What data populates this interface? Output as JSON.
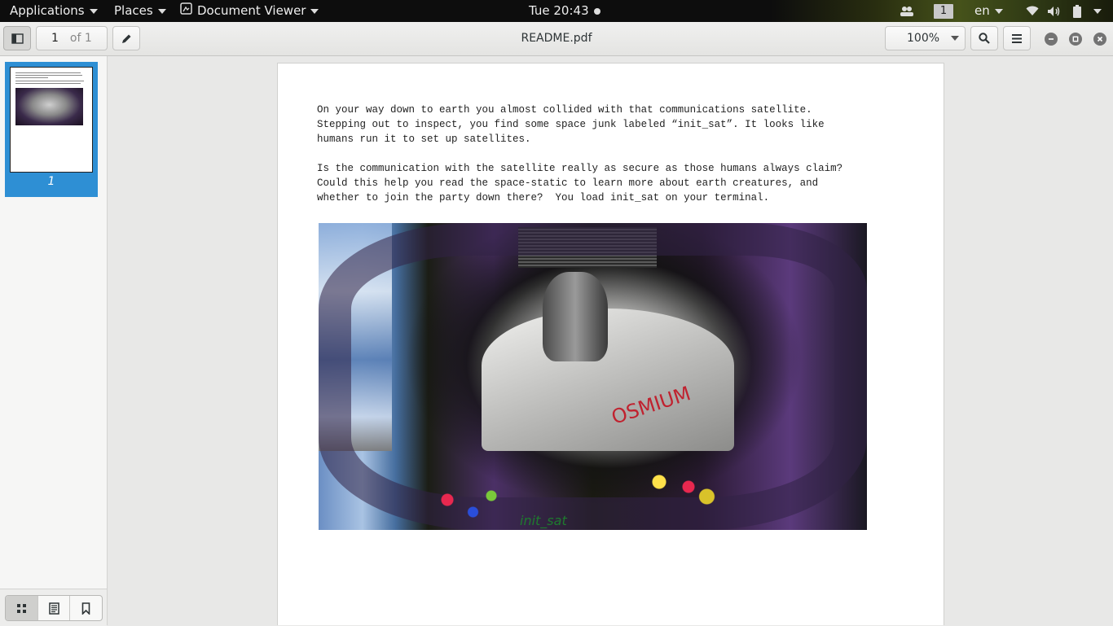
{
  "topbar": {
    "applications": "Applications",
    "places": "Places",
    "app_name": "Document Viewer",
    "clock": "Tue 20:43",
    "workspace": "1",
    "keyboard_layout": "en"
  },
  "header": {
    "page_number": "1",
    "page_count": "of 1",
    "title": "README.pdf",
    "zoom": "100%"
  },
  "sidebar": {
    "thumbnail_label": "1"
  },
  "document": {
    "paragraph1": "On your way down to earth you almost collided with that communications satellite.\nStepping out to inspect, you find some space junk labeled “init_sat”. It looks like\nhumans run it to set up satellites.",
    "paragraph2": "Is the communication with the satellite really as secure as those humans always claim?\nCould this help you read the space-static to learn more about earth creatures, and\nwhether to join the party down there?  You load init_sat on your terminal.",
    "figure_scrawl": "OSMIUM",
    "figure_caption": "init_sat"
  },
  "icons": {
    "sidebar_toggle": "sidebar-icon",
    "annotate": "pencil-icon",
    "search": "search-icon",
    "menu": "hamburger-menu-icon",
    "minimize": "minimize-icon",
    "maximize": "maximize-icon",
    "close": "close-icon"
  },
  "colors": {
    "selection": "#2e8fd4",
    "topbar": "#0d0d0d"
  }
}
